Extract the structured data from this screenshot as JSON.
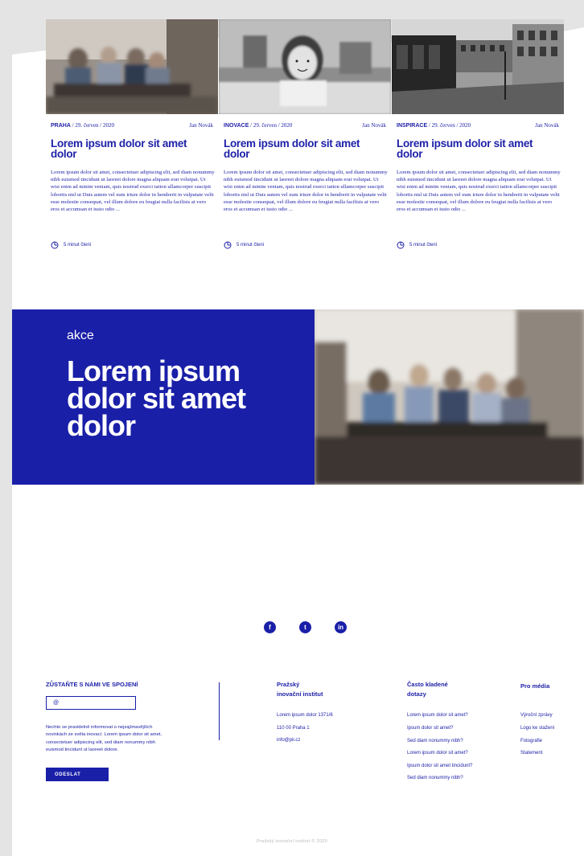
{
  "cards": [
    {
      "category": "PRAHA",
      "date": "29. červen / 2020",
      "author": "Jan Novák",
      "title": "Lorem ipsum dolor sit amet dolor",
      "excerpt": "Lorem ipsum dolor sit amet, consectetuer adipiscing elit, sed diam nonummy nibh euismod tincidunt ut laoreet dolore magna aliquam erat volutpat. Ut wisi enim ad minim veniam, quis nostrud exerci tation ullamcorper suscipit lobortis nisl ut Duis autem vel eum iriure dolor in hendrerit in vulputate velit esse molestie consequat, vel illum dolore eu feugiat nulla facilisis at vero eros et accumsan et iusto odio ...",
      "read_time": "5 minut čtení"
    },
    {
      "category": "INOVACE",
      "date": "29. červen / 2020",
      "author": "Jan Novák",
      "title": "Lorem ipsum dolor sit amet dolor",
      "excerpt": "Lorem ipsum dolor sit amet, consectetuer adipiscing elit, sed diam nonummy nibh euismod tincidunt ut laoreet dolore magna aliquam erat volutpat. Ut wisi enim ad minim veniam, quis nostrud exerci tation ullamcorper suscipit lobortis nisl ut Duis autem vel eum iriure dolor in hendrerit in vulputate velit esse molestie consequat, vel illum dolore eu feugiat nulla facilisis at vero eros et accumsan et iusto odio ...",
      "read_time": "5 minut čtení"
    },
    {
      "category": "INSPIRACE",
      "date": "29. červen / 2020",
      "author": "Jan Novák",
      "title": "Lorem ipsum dolor sit amet dolor",
      "excerpt": "Lorem ipsum dolor sit amet, consectetuer adipiscing elit, sed diam nonummy nibh euismod tincidunt ut laoreet dolore magna aliquam erat volutpat. Ut wisi enim ad minim veniam, quis nostrud exerci tation ullamcorper suscipit lobortis nisl ut Duis autem vel eum iriure dolor in hendrerit in vulputate velit esse molestie consequat, vel illum dolore eu feugiat nulla facilisis at vero eros et accumsan et iusto odio ...",
      "read_time": "5 minut čtení"
    }
  ],
  "hero": {
    "tag": "akce",
    "title": "Lorem ipsum dolor sit amet dolor"
  },
  "social": [
    {
      "icon": "facebook-icon",
      "glyph": "f"
    },
    {
      "icon": "twitter-icon",
      "glyph": "t"
    },
    {
      "icon": "linkedin-icon",
      "glyph": "in"
    }
  ],
  "footer": {
    "newsletter_title": "ZŮSTAŇTE S NÁMI VE SPOJENÍ",
    "email_placeholder": "@",
    "newsletter_text": "Nechte se pravidelně informovat o nejzajímavějších novinkách ze světa inovací. Lorem ipsum dolor sit amet, consectetuer adipiscing elit, sed diam nonummy nibh euismod tincidunt ut laoreet dolore.",
    "submit_label": "ODESLAT",
    "org_title_1": "Pražský",
    "org_title_2": "inovační institut",
    "org_lines": [
      "Lorem ipsum dolor 1371/6",
      "110 00 Praha 1",
      "info@pii.cz"
    ],
    "faq_title_1": "Často kladené",
    "faq_title_2": "dotazy",
    "faq_links": [
      "Lorem ipsum dolor sit amet?",
      "Ipsum dolor sit amet?",
      "Sed diam nonummy nibh?",
      "Lorem ipsum dolor sit amet?",
      "Ipsum dolor sit amet tincidunt?",
      "Sed diam nonummy nibh?"
    ],
    "media_title": "Pro média",
    "media_links": [
      "Výroční zprávy",
      "Logo ke stažení",
      "Fotografie",
      "Statement"
    ],
    "copyright": "Pražský inovační institut © 2020"
  },
  "colors": {
    "brand": "#1a1fa8",
    "background": "#ffffff",
    "gutter": "#e4e4e4"
  }
}
